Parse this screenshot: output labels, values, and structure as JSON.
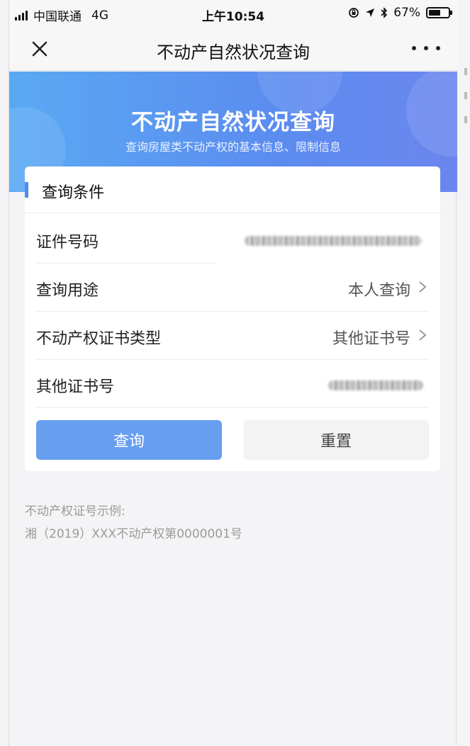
{
  "status_bar": {
    "carrier": "中国联通",
    "network": "4G",
    "time": "上午10:54",
    "battery": "67%",
    "battery_level": 0.67
  },
  "nav": {
    "title": "不动产自然状况查询"
  },
  "banner": {
    "title": "不动产自然状况查询",
    "subtitle": "查询房屋类不动产权的基本信息、限制信息"
  },
  "form": {
    "section_title": "查询条件",
    "rows": [
      {
        "label": "证件号码",
        "value": ""
      },
      {
        "label": "查询用途",
        "value": "本人查询"
      },
      {
        "label": "不动产权证书类型",
        "value": "其他证书号"
      },
      {
        "label": "其他证书号",
        "value": ""
      }
    ],
    "query_button": "查询",
    "reset_button": "重置"
  },
  "example": {
    "heading": "不动产权证号示例:",
    "text": "湘（2019）XXX不动产权第0000001号"
  },
  "colors": {
    "accent": "#4e8cf0",
    "banner_start": "#5aa9f3",
    "banner_end": "#6b86ee",
    "query_button": "#679ef0"
  }
}
